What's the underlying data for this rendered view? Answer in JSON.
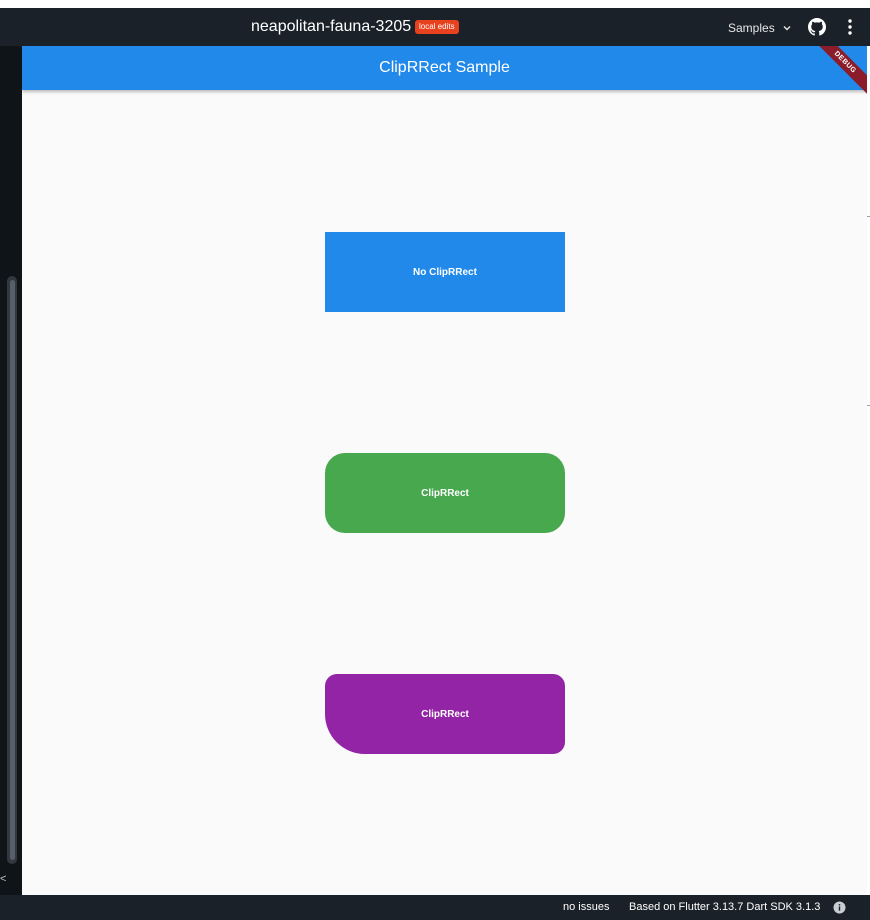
{
  "topbar": {
    "project_name": "neapolitan-fauna-3205",
    "badge": "local edits",
    "samples_label": "Samples",
    "icons": [
      "chevron-down-icon",
      "github-icon",
      "more-vert-icon"
    ]
  },
  "left_rail": {
    "glyph": "<"
  },
  "app": {
    "title": "ClipRRect Sample",
    "debug_banner": "DEBUG",
    "boxes": [
      {
        "label": "No ClipRRect",
        "color": "#2189ea"
      },
      {
        "label": "ClipRRect",
        "color": "#47a84e"
      },
      {
        "label": "ClipRRect",
        "color": "#9324a5"
      }
    ]
  },
  "statusbar": {
    "issues": "no issues",
    "version": "Based on Flutter 3.13.7 Dart SDK 3.1.3",
    "icon": "info-icon"
  },
  "colors": {
    "chrome_dark": "#1b2128",
    "badge_red": "#e8411d",
    "appbar_blue": "#2189ea",
    "debug_red": "#8b1d2b",
    "canvas": "#fafafa"
  }
}
